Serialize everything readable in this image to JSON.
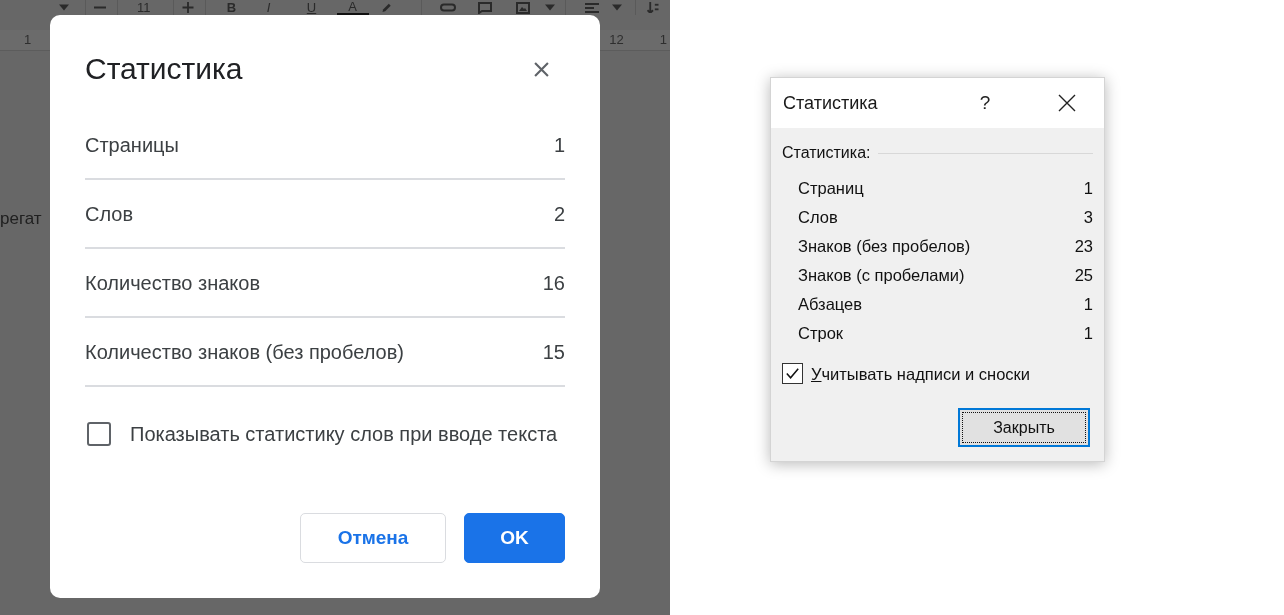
{
  "editor": {
    "toolbar": {
      "font_size": "11",
      "format_letters": [
        {
          "text": "B",
          "kind": "bold"
        },
        {
          "text": "I",
          "kind": "italic"
        },
        {
          "text": "U",
          "kind": "underline"
        },
        {
          "text": "A",
          "kind": "color"
        }
      ]
    },
    "ruler": {
      "marks": [
        "1",
        "12",
        "1"
      ]
    },
    "document_text": "регат"
  },
  "google_dialog": {
    "title": "Статистика",
    "rows": [
      {
        "label": "Страницы",
        "value": "1"
      },
      {
        "label": "Слов",
        "value": "2"
      },
      {
        "label": "Количество знаков",
        "value": "16"
      },
      {
        "label": "Количество знаков (без пробелов)",
        "value": "15"
      }
    ],
    "checkbox": {
      "label": "Показывать статистику слов при вводе текста",
      "checked": false
    },
    "buttons": [
      {
        "label": "Отмена",
        "kind": "secondary"
      },
      {
        "label": "OK",
        "kind": "primary"
      }
    ]
  },
  "word_dialog": {
    "title": "Статистика",
    "help": "?",
    "group_label": "Статистика:",
    "rows": [
      {
        "label": "Страниц",
        "value": "1"
      },
      {
        "label": "Слов",
        "value": "3"
      },
      {
        "label": "Знаков (без пробелов)",
        "value": "23"
      },
      {
        "label": "Знаков (с пробелами)",
        "value": "25"
      },
      {
        "label": "Абзацев",
        "value": "1"
      },
      {
        "label": "Строк",
        "value": "1"
      }
    ],
    "checkbox": {
      "label": "Учитывать надписи и сноски",
      "checked": true,
      "mnemonic": true
    },
    "button": {
      "label": "Закрыть",
      "focused": true
    }
  }
}
